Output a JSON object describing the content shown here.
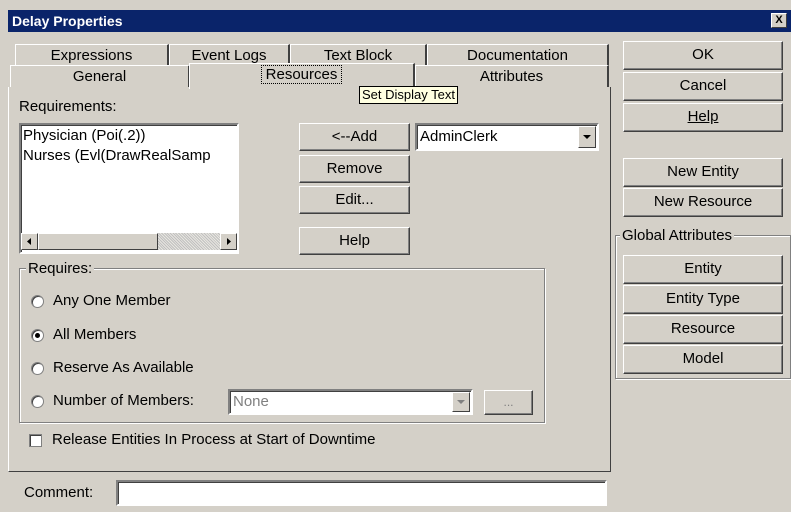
{
  "window": {
    "title": "Delay Properties",
    "close_glyph": "X"
  },
  "tabs_back": [
    "Expressions",
    "Event Logs",
    "Text Block",
    "Documentation"
  ],
  "tabs_front": [
    "General",
    "Resources",
    "Attributes"
  ],
  "tooltip": "Set Display Text",
  "requirements": {
    "label": "Requirements:",
    "items": [
      "Physician (Poi(.2))",
      "Nurses (Evl(DrawRealSamp"
    ]
  },
  "actions": {
    "add": "<--Add",
    "remove": "Remove",
    "edit": "Edit...",
    "help": "Help"
  },
  "resource_select": {
    "value": "AdminClerk"
  },
  "requires": {
    "legend": "Requires:",
    "options": [
      "Any One Member",
      "All Members",
      "Reserve As Available",
      "Number of Members:"
    ],
    "selected_index": 1,
    "number_value": "None",
    "ellipsis": "..."
  },
  "release_check": {
    "label": "Release Entities In Process at Start of Downtime",
    "checked": false
  },
  "comment": {
    "label": "Comment:",
    "value": ""
  },
  "side_buttons": {
    "ok": "OK",
    "cancel": "Cancel",
    "help": "Help",
    "new_entity": "New Entity",
    "new_resource": "New Resource"
  },
  "global_attributes": {
    "legend": "Global Attributes",
    "buttons": [
      "Entity",
      "Entity Type",
      "Resource",
      "Model"
    ]
  }
}
